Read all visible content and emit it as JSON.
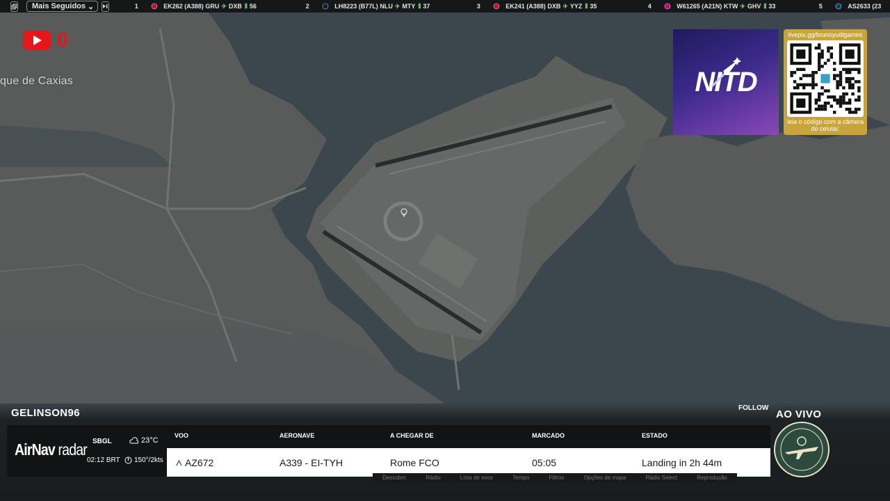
{
  "topbar": {
    "filter_label": "Mais Seguidos",
    "flights": [
      {
        "rank": "1",
        "callsign": "EK262",
        "aircraft": "(A388)",
        "from": "GRU",
        "to": "DXB",
        "count": "56",
        "logo_color": "#c8102e"
      },
      {
        "rank": "2",
        "callsign": "LH8223",
        "aircraft": "(B77L)",
        "from": "NLU",
        "to": "MTY",
        "count": "37",
        "logo_color": "#0a1d3d"
      },
      {
        "rank": "3",
        "callsign": "EK241",
        "aircraft": "(A388)",
        "from": "DXB",
        "to": "YYZ",
        "count": "35",
        "logo_color": "#c8102e"
      },
      {
        "rank": "4",
        "callsign": "W61265",
        "aircraft": "(A21N)",
        "from": "KTW",
        "to": "GHV",
        "count": "33",
        "logo_color": "#c6007e"
      },
      {
        "rank": "5",
        "callsign": "AS2633",
        "aircraft": "(23",
        "from": "",
        "to": "",
        "count": "",
        "logo_color": "#01426a"
      }
    ]
  },
  "map": {
    "place_label": "que de Caxias",
    "colors": {
      "water": "#3b474c",
      "land": "#5a5d5b",
      "runway": "#2a2b2c"
    }
  },
  "overlay": {
    "yt_count": "0",
    "sponsor_text": "NITD",
    "qr_url": "livepix.gg/brunoyudigames",
    "qr_caption": "leia o código com a câmera do celular."
  },
  "bottom": {
    "username": "GELINSON96",
    "follow_label": "FOLLOW",
    "live_label": "AO VIVO",
    "brand_prefix": "AirNav",
    "brand_suffix": " radar",
    "airport": "SBGL",
    "local_time": "02:12 BRT",
    "temperature": "23°C",
    "wind": "150°/2kts",
    "headers": {
      "flight": "VOO",
      "aircraft": "AERONAVE",
      "origin": "A CHEGAR DE",
      "scheduled": "MARCADO",
      "status": "ESTADO"
    },
    "row": {
      "flight": "AZ672",
      "aircraft": "A339 - EI-TYH",
      "origin": "Rome FCO",
      "scheduled": "05:05",
      "status": "Landing in 2h 44m"
    },
    "nav_items": [
      "Descobrir",
      "Rádio",
      "Lista de voos",
      "Tempo",
      "Filtros",
      "Opções de mapa",
      "Rádio Select",
      "Reprodução"
    ]
  }
}
